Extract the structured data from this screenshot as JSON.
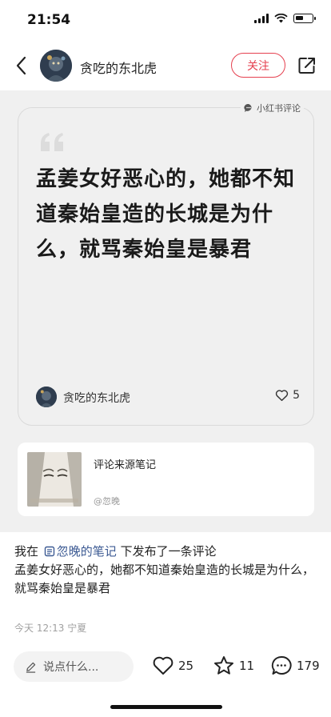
{
  "status_bar": {
    "time": "21:54"
  },
  "header": {
    "author_name": "贪吃的东北虎",
    "follow_label": "关注"
  },
  "card": {
    "source_label": "小红书评论",
    "quote": "孟姜女好恶心的，她都不知道秦始皇造的长城是为什么，就骂秦始皇是暴君",
    "author_name": "贪吃的东北虎",
    "likes": "5"
  },
  "source_note": {
    "title": "评论来源笔记",
    "author": "@忽晚"
  },
  "comment": {
    "prefix": "我在",
    "note_link": "忽晚的笔记",
    "suffix": "下发布了一条评论",
    "body": "孟姜女好恶心的，她都不知道秦始皇造的长城是为什么，就骂秦始皇是暴君",
    "meta": "今天 12:13 宁夏"
  },
  "bottom_bar": {
    "input_placeholder": "说点什么...",
    "likes": "25",
    "favorites": "11",
    "comments": "179"
  },
  "colors": {
    "accent": "#e5404f",
    "link": "#3c5a93",
    "background_gray": "#f0f0f0"
  },
  "icons": [
    "signal-icon",
    "wifi-icon",
    "battery-icon",
    "back-icon",
    "share-icon",
    "chat-icon",
    "quote-icon",
    "heart-icon",
    "note-icon",
    "pencil-icon",
    "star-icon",
    "comment-icon"
  ]
}
